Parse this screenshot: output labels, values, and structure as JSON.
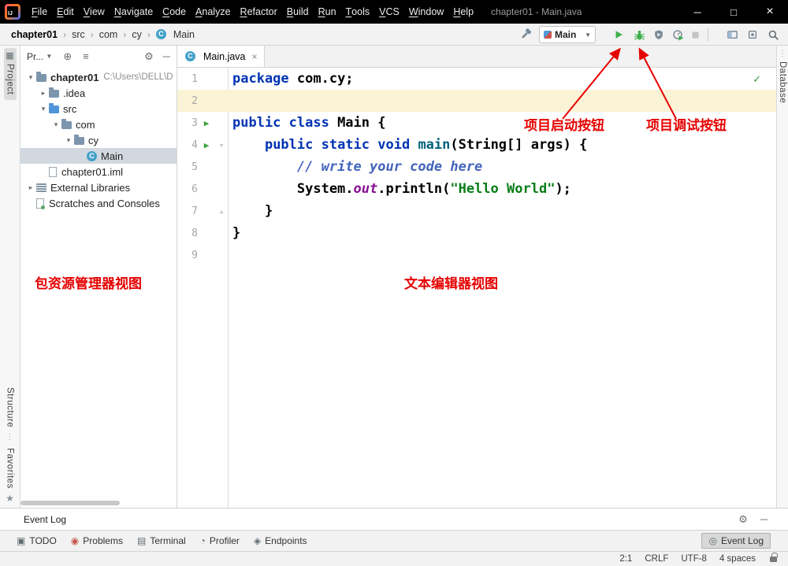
{
  "titlebar": {
    "menus": [
      "File",
      "Edit",
      "View",
      "Navigate",
      "Code",
      "Analyze",
      "Refactor",
      "Build",
      "Run",
      "Tools",
      "VCS",
      "Window",
      "Help"
    ],
    "title": "chapter01 - Main.java"
  },
  "navbar": {
    "breadcrumbs": [
      "chapter01",
      "src",
      "com",
      "cy",
      "Main"
    ],
    "separator": "›",
    "run_config": {
      "label": "Main"
    }
  },
  "stripes": {
    "project": "Project",
    "structure": "Structure",
    "favorites": "Favorites",
    "database": "Database"
  },
  "project_panel": {
    "header": {
      "title": "Pr..."
    },
    "tree": [
      {
        "label": "chapter01",
        "suffix": "C:\\Users\\DELL\\D",
        "indent": 0,
        "chevron": "expanded",
        "icon": "folder",
        "bold": true,
        "selected": false
      },
      {
        "label": ".idea",
        "indent": 1,
        "chevron": "collapsed",
        "icon": "folder",
        "bold": false,
        "selected": false
      },
      {
        "label": "src",
        "indent": 1,
        "chevron": "expanded",
        "icon": "folder-src",
        "bold": false,
        "selected": false
      },
      {
        "label": "com",
        "indent": 2,
        "chevron": "expanded",
        "icon": "folder",
        "bold": false,
        "selected": false
      },
      {
        "label": "cy",
        "indent": 3,
        "chevron": "expanded",
        "icon": "folder",
        "bold": false,
        "selected": false
      },
      {
        "label": "Main",
        "indent": 4,
        "chevron": "none",
        "icon": "class",
        "bold": false,
        "selected": true
      },
      {
        "label": "chapter01.iml",
        "indent": 1,
        "chevron": "none",
        "icon": "file",
        "bold": false,
        "selected": false
      },
      {
        "label": "External Libraries",
        "indent": 0,
        "chevron": "collapsed",
        "icon": "library",
        "bold": false,
        "selected": false
      },
      {
        "label": "Scratches and Consoles",
        "indent": 0,
        "chevron": "none",
        "icon": "scratch",
        "bold": false,
        "selected": false
      }
    ],
    "annotation": "包资源管理器视图"
  },
  "editor": {
    "tab": "Main.java",
    "lines": [
      {
        "n": 1,
        "caret": false,
        "run": false,
        "fold": "",
        "segs": [
          {
            "t": "kw",
            "s": "package"
          },
          {
            "t": "pl",
            "s": " com.cy;"
          }
        ]
      },
      {
        "n": 2,
        "caret": true,
        "run": false,
        "fold": "",
        "segs": []
      },
      {
        "n": 3,
        "caret": false,
        "run": true,
        "fold": "",
        "segs": [
          {
            "t": "kw",
            "s": "public class"
          },
          {
            "t": "pl",
            "s": " Main {"
          }
        ]
      },
      {
        "n": 4,
        "caret": false,
        "run": true,
        "fold": "down",
        "segs": [
          {
            "t": "pl",
            "s": "    "
          },
          {
            "t": "kw",
            "s": "public static void"
          },
          {
            "t": "pl",
            "s": " "
          },
          {
            "t": "mth",
            "s": "main"
          },
          {
            "t": "pl",
            "s": "(String[] args) {"
          }
        ]
      },
      {
        "n": 5,
        "caret": false,
        "run": false,
        "fold": "",
        "segs": [
          {
            "t": "pl",
            "s": "        "
          },
          {
            "t": "cm",
            "s": "// write your code here"
          }
        ]
      },
      {
        "n": 6,
        "caret": false,
        "run": false,
        "fold": "",
        "segs": [
          {
            "t": "pl",
            "s": "        System."
          },
          {
            "t": "fld",
            "s": "out"
          },
          {
            "t": "pl",
            "s": ".println("
          },
          {
            "t": "str",
            "s": "\"Hello World\""
          },
          {
            "t": "pl",
            "s": ");"
          }
        ]
      },
      {
        "n": 7,
        "caret": false,
        "run": false,
        "fold": "up",
        "segs": [
          {
            "t": "pl",
            "s": "    }"
          }
        ]
      },
      {
        "n": 8,
        "caret": false,
        "run": false,
        "fold": "",
        "segs": [
          {
            "t": "pl",
            "s": "}"
          }
        ]
      },
      {
        "n": 9,
        "caret": false,
        "run": false,
        "fold": "",
        "segs": []
      }
    ],
    "annotations": {
      "run_button": "项目启动按钮",
      "debug_button": "项目调试按钮",
      "editor_view": "文本编辑器视图"
    }
  },
  "eventlog": {
    "title": "Event Log"
  },
  "bottom_bar": {
    "left": [
      {
        "label": "TODO",
        "icon": "todo-icon"
      },
      {
        "label": "Problems",
        "icon": "problems-icon"
      },
      {
        "label": "Terminal",
        "icon": "terminal-icon"
      },
      {
        "label": "Profiler",
        "icon": "profiler-icon"
      },
      {
        "label": "Endpoints",
        "icon": "endpoints-icon"
      }
    ],
    "right": [
      {
        "label": "Event Log",
        "icon": "eventlog-icon"
      }
    ]
  },
  "statusbar": {
    "items": [
      "2:1",
      "CRLF",
      "UTF-8",
      "4 spaces"
    ]
  }
}
